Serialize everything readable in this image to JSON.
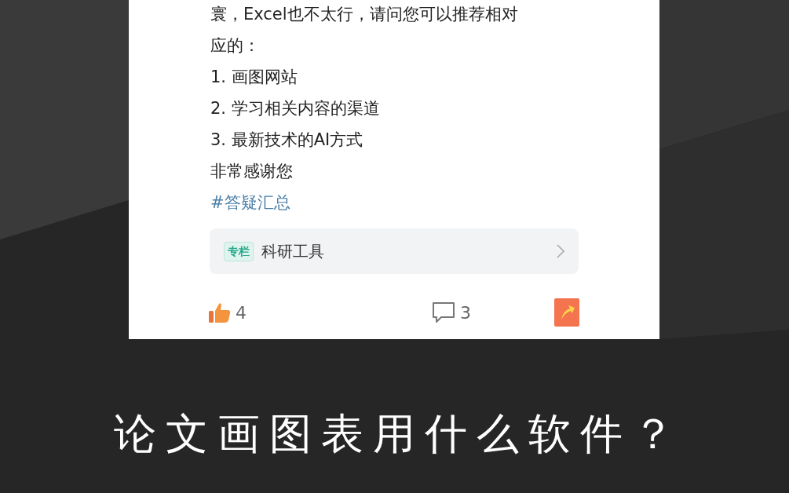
{
  "post": {
    "lines": [
      "寰，Excel也不太行，请问您可以推荐相对",
      "应的：",
      "1. 画图网站",
      "2. 学习相关内容的渠道",
      "3. 最新技术的AI方式",
      "非常感谢您"
    ],
    "hashtag": "#答疑汇总",
    "column": {
      "badge": "专栏",
      "title": "科研工具"
    },
    "actions": {
      "likes": "4",
      "comments": "3"
    }
  },
  "caption": "论文画图表用什么软件？"
}
